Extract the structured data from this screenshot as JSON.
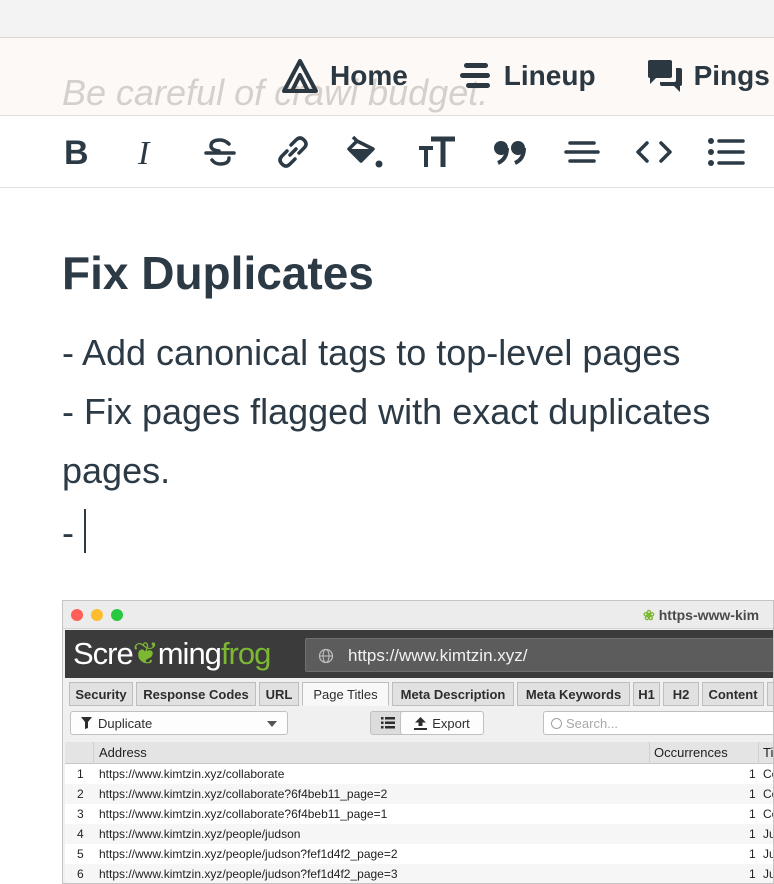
{
  "nav": {
    "placeholder_text": "Be careful of crawl budget.",
    "items": [
      {
        "label": "Home",
        "icon": "campfire-icon"
      },
      {
        "label": "Lineup",
        "icon": "lineup-icon"
      },
      {
        "label": "Pings",
        "icon": "chat-bubbles-icon"
      }
    ]
  },
  "toolbar": {
    "buttons": [
      "bold-icon",
      "italic-icon",
      "strikethrough-icon",
      "link-icon",
      "fill-color-icon",
      "text-size-icon",
      "quote-icon",
      "horizontal-rule-icon",
      "code-icon",
      "bullet-list-icon"
    ]
  },
  "document": {
    "heading": "Fix Duplicates",
    "lines": [
      "- Add canonical tags to top-level pages",
      "- Fix pages flagged with exact duplicates",
      "pages.",
      "-"
    ]
  },
  "screenshot": {
    "window_title": "https-www-kim",
    "logo_part1": "Scre",
    "logo_part2": "ming",
    "logo_part3": "frog",
    "url": "https://www.kimtzin.xyz/",
    "tabs": [
      "Security",
      "Response Codes",
      "URL",
      "Page Titles",
      "Meta Description",
      "Meta Keywords",
      "H1",
      "H2",
      "Content",
      ""
    ],
    "active_tab": "Page Titles",
    "filter": "Duplicate",
    "export_label": "Export",
    "search_placeholder": "Search...",
    "columns": [
      "Address",
      "Occurrences",
      "Ti"
    ],
    "rows": [
      {
        "n": "1",
        "address": "https://www.kimtzin.xyz/collaborate",
        "occ": "1",
        "title": "Co"
      },
      {
        "n": "2",
        "address": "https://www.kimtzin.xyz/collaborate?6f4beb11_page=2",
        "occ": "1",
        "title": "Co"
      },
      {
        "n": "3",
        "address": "https://www.kimtzin.xyz/collaborate?6f4beb11_page=1",
        "occ": "1",
        "title": "Co"
      },
      {
        "n": "4",
        "address": "https://www.kimtzin.xyz/people/judson",
        "occ": "1",
        "title": "Ju"
      },
      {
        "n": "5",
        "address": "https://www.kimtzin.xyz/people/judson?fef1d4f2_page=2",
        "occ": "1",
        "title": "Ju"
      },
      {
        "n": "6",
        "address": "https://www.kimtzin.xyz/people/judson?fef1d4f2_page=3",
        "occ": "1",
        "title": "Ju"
      }
    ],
    "colors": {
      "header_bg": "#3b3b3b",
      "frog_green": "#7cb832",
      "close": "#ff5f57",
      "minimize": "#febc2e",
      "zoom": "#28c840"
    }
  }
}
